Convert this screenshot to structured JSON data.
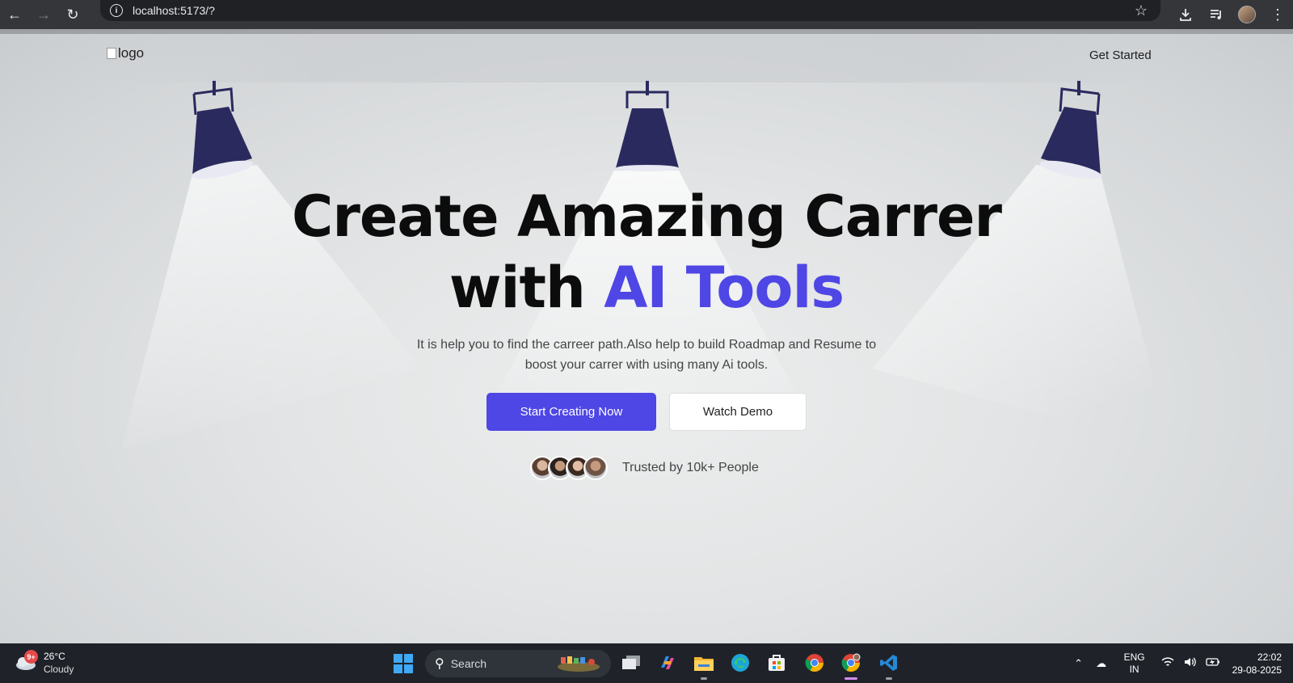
{
  "browser": {
    "url": "localhost:5173/?",
    "icons": [
      "back-arrow-icon",
      "forward-arrow-icon",
      "reload-icon",
      "site-info-icon",
      "bookmark-star-icon",
      "download-icon",
      "media-control-icon",
      "profile-avatar",
      "menu-kebab-icon"
    ]
  },
  "header": {
    "logo_alt": "logo",
    "cta": "Get Started"
  },
  "hero": {
    "title_line1": "Create Amazing Carrer",
    "title_line2_plain": "with",
    "title_line2_accent": "AI Tools",
    "subtitle_line1": "It is help you to find the carreer path.Also help to build Roadmap and Resume to",
    "subtitle_line2": "boost your carrer with using many Ai tools.",
    "primary_button": "Start Creating Now",
    "secondary_button": "Watch Demo",
    "trust_text": "Trusted by 10k+ People"
  },
  "colors": {
    "accent": "#4e46e5",
    "lamp": "#2b2a5e",
    "taskbar": "#1f2329"
  },
  "taskbar": {
    "weather_badge": "9+",
    "temperature": "26°C",
    "condition": "Cloudy",
    "search_label": "Search",
    "lang_line1": "ENG",
    "lang_line2": "IN",
    "time": "22:02",
    "date": "29-08-2025",
    "apps": [
      "task-view-icon",
      "copilot-icon",
      "file-explorer-icon",
      "edge-icon",
      "store-icon",
      "chrome-icon",
      "chrome-profile-icon",
      "vscode-icon"
    ]
  }
}
